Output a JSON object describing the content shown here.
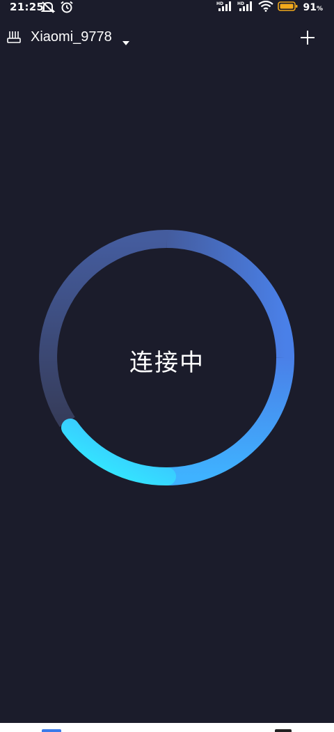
{
  "status_bar": {
    "time": "21:25",
    "battery_percent": "91",
    "battery_unit": "%"
  },
  "header": {
    "router_name": "Xiaomi_9778"
  },
  "connection": {
    "status_text": "连接中",
    "colors": {
      "ring_start": "#30f4ff",
      "ring_end": "#4a80e8",
      "ring_fade": "#3a4160",
      "background": "#1b1c2b"
    }
  },
  "icons": {
    "router": "router-icon",
    "dropdown": "dropdown-triangle-icon",
    "add": "plus-icon"
  }
}
